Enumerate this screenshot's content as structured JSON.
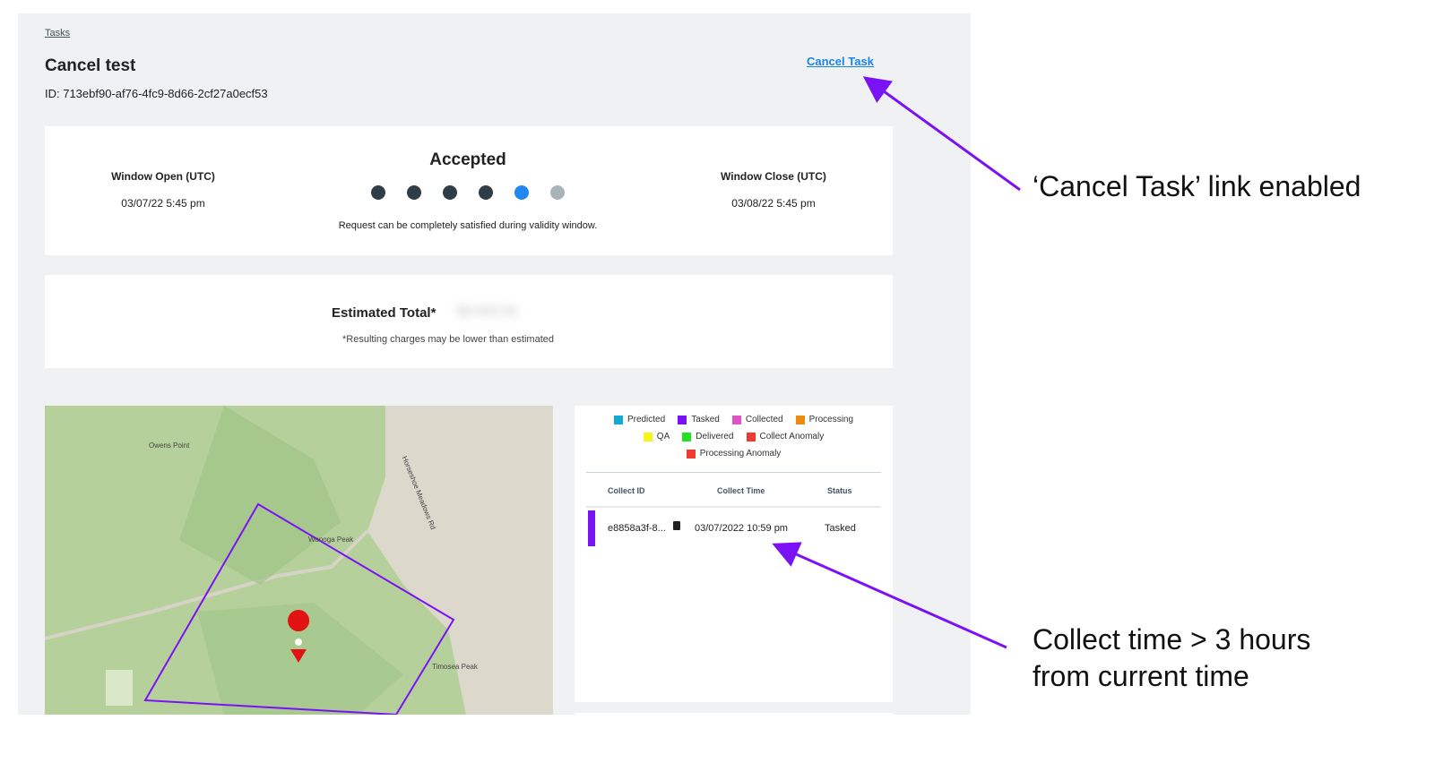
{
  "breadcrumb": "Tasks",
  "title": "Cancel test",
  "task_id": "ID: 713ebf90-af76-4fc9-8d66-2cf27a0ecf53",
  "cancel_link": "Cancel Task",
  "status": {
    "label": "Accepted",
    "description": "Request can be completely satisfied during validity window.",
    "steps": [
      "#2f3e46",
      "#2f3e46",
      "#2f3e46",
      "#2f3e46",
      "#2188f0",
      "#a9b4ba"
    ],
    "current_step": 5
  },
  "window_open": {
    "label": "Window Open (UTC)",
    "value": "03/07/22 5:45 pm"
  },
  "window_close": {
    "label": "Window Close (UTC)",
    "value": "03/08/22 5:45 pm"
  },
  "estimate": {
    "label": "Estimated Total*",
    "value": "$0,000.00",
    "note": "*Resulting charges may be lower than estimated"
  },
  "map": {
    "labels": [
      "Owens Point",
      "Horseshoe Meadows Rd",
      "Wonoga Peak",
      "Timosea Peak"
    ]
  },
  "legend": [
    {
      "label": "Predicted",
      "color": "#12a9d6"
    },
    {
      "label": "Tasked",
      "color": "#7a12f5"
    },
    {
      "label": "Collected",
      "color": "#e052c8"
    },
    {
      "label": "Processing",
      "color": "#ee8a12"
    },
    {
      "label": "QA",
      "color": "#f7f51e"
    },
    {
      "label": "Delivered",
      "color": "#22e022"
    },
    {
      "label": "Collect Anomaly",
      "color": "#f03a30"
    },
    {
      "label": "Processing Anomaly",
      "color": "#f03a30"
    }
  ],
  "table": {
    "headers": [
      "Collect ID",
      "Collect Time",
      "Status"
    ],
    "rows": [
      {
        "id": "e8858a3f-8...",
        "time": "03/07/2022 10:59 pm",
        "status": "Tasked",
        "color": "#7a12f5"
      }
    ]
  },
  "annotations": [
    "‘Cancel Task’ link enabled",
    "Collect time > 3 hours",
    "from current time"
  ]
}
